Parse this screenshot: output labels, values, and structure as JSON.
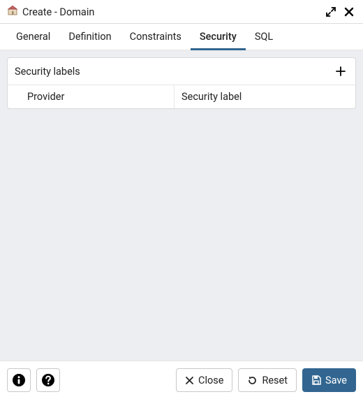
{
  "header": {
    "title": "Create - Domain"
  },
  "tabs": [
    {
      "label": "General",
      "active": false
    },
    {
      "label": "Definition",
      "active": false
    },
    {
      "label": "Constraints",
      "active": false
    },
    {
      "label": "Security",
      "active": true
    },
    {
      "label": "SQL",
      "active": false
    }
  ],
  "security": {
    "panel_title": "Security labels",
    "columns": {
      "provider": "Provider",
      "security_label": "Security label"
    },
    "rows": []
  },
  "footer": {
    "close_label": "Close",
    "reset_label": "Reset",
    "save_label": "Save"
  },
  "colors": {
    "accent": "#326690",
    "body_bg": "#eceef1"
  }
}
